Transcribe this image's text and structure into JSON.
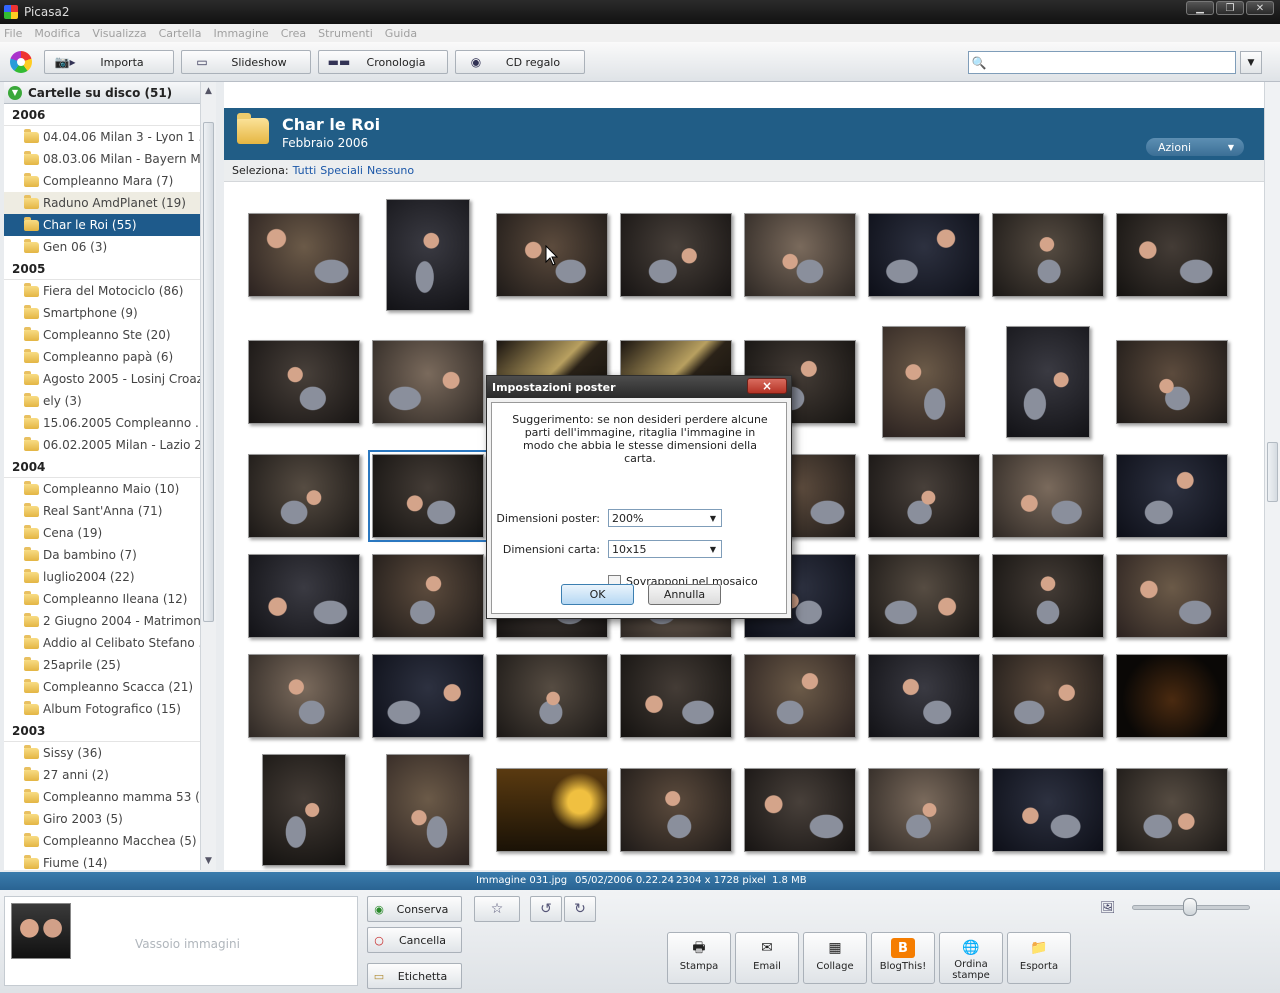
{
  "window": {
    "title": "Picasa2"
  },
  "menu": [
    "File",
    "Modifica",
    "Visualizza",
    "Cartella",
    "Immagine",
    "Crea",
    "Strumenti",
    "Guida"
  ],
  "toolbar": {
    "import": "Importa",
    "slideshow": "Slideshow",
    "timeline": "Cronologia",
    "cdgift": "CD regalo"
  },
  "search": {
    "value": "",
    "placeholder": ""
  },
  "sidebar": {
    "header": "Cartelle su disco (51)",
    "groups": [
      {
        "year": "2006",
        "folders": [
          "04.04.06 Milan 3 - Lyon 1 ...",
          "08.03.06 Milan - Bayern M...",
          "Compleanno Mara (7)",
          "Raduno AmdPlanet (19)",
          "Char le Roi (55)",
          "Gen 06 (3)"
        ]
      },
      {
        "year": "2005",
        "folders": [
          "Fiera del Motociclo (86)",
          "Smartphone (9)",
          "Compleanno Ste (20)",
          "Compleanno papà (6)",
          "Agosto 2005 - Losinj Croaz...",
          "ely (3)",
          "15.06.2005 Compleanno ...",
          "06.02.2005 Milan - Lazio 2-..."
        ]
      },
      {
        "year": "2004",
        "folders": [
          "Compleanno Maio (10)",
          "Real Sant'Anna (71)",
          "Cena (19)",
          "Da bambino (7)",
          "luglio2004 (22)",
          "Compleanno Ileana (12)",
          "2 Giugno 2004 - Matrimoni...",
          "Addio al Celibato Stefano ...",
          "25aprile (25)",
          "Compleanno Scacca (21)",
          "Album Fotografico (15)"
        ]
      },
      {
        "year": "2003",
        "folders": [
          "Sissy (36)",
          "27 anni (2)",
          "Compleanno mamma 53 (4)",
          "Giro 2003 (5)",
          "Compleanno Macchea (5)",
          "Fiume (14)"
        ]
      }
    ],
    "selected": "Char le Roi (55)",
    "hovered": "Raduno AmdPlanet (19)"
  },
  "album": {
    "title": "Char le Roi",
    "date": "Febbraio 2006",
    "actions": "Azioni",
    "select_label": "Seleziona:",
    "select_all": "Tutti",
    "select_special": "Speciali",
    "select_none": "Nessuno"
  },
  "status": {
    "filename": "Immagine 031.jpg",
    "datetime": "05/02/2006 0.22.24",
    "dimensions": "2304 x 1728 pixel",
    "size": "1.8 MB"
  },
  "tray": {
    "label": "Vassoio immagini"
  },
  "bottom": {
    "keep": "Conserva",
    "delete": "Cancella",
    "label": "Etichetta"
  },
  "actions": [
    {
      "label": "Stampa",
      "icon": "printer-icon"
    },
    {
      "label": "Email",
      "icon": "email-icon"
    },
    {
      "label": "Collage",
      "icon": "collage-icon"
    },
    {
      "label": "BlogThis!",
      "icon": "blogger-icon"
    },
    {
      "label": "Ordina stampe",
      "icon": "order-prints-icon"
    },
    {
      "label": "Esporta",
      "icon": "export-icon"
    }
  ],
  "dialog": {
    "title": "Impostazioni poster",
    "hint": "Suggerimento: se non desideri perdere alcune parti dell'immagine, ritaglia l'immagine in modo che abbia le stesse dimensioni della carta.",
    "poster_label": "Dimensioni poster:",
    "poster_value": "200%",
    "paper_label": "Dimensioni carta:",
    "paper_value": "10x15",
    "tile_label": "Sovrapponi nel mosaico",
    "tile_checked": false,
    "ok": "OK",
    "cancel": "Annulla"
  },
  "icons": {
    "close": "×",
    "dropdown": "▼"
  }
}
